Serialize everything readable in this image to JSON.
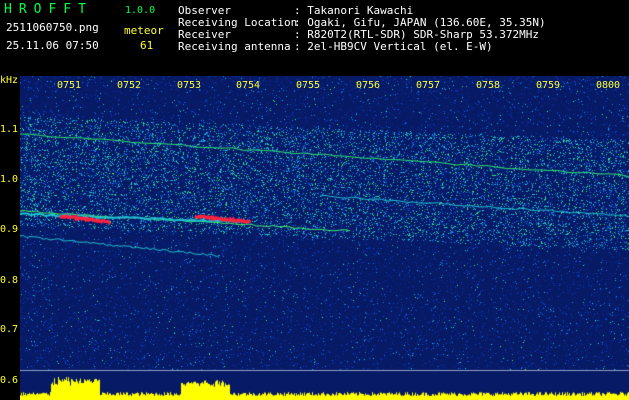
{
  "header": {
    "app_title": "HROFFT",
    "version": "1.0.0",
    "filename": "2511060750.png",
    "datetime": "25.11.06 07:50",
    "meteor_label": "meteor",
    "meteor_count": "61"
  },
  "info": [
    {
      "key": "Observer",
      "value": ": Takanori Kawachi"
    },
    {
      "key": "Receiving Location",
      "value": ": Ogaki, Gifu, JAPAN (136.60E, 35.35N)"
    },
    {
      "key": "Receiver",
      "value": ": R820T2(RTL-SDR) SDR-Sharp 53.372MHz"
    },
    {
      "key": "Receiving antenna",
      "value": ": 2el-HB9CV Vertical (el. E-W)"
    }
  ],
  "axis": {
    "unit": "kHz",
    "y_ticks": [
      "1.1",
      "1.0",
      "0.9",
      "0.8",
      "0.7",
      "0.6"
    ],
    "x_ticks": [
      "0751",
      "0752",
      "0753",
      "0754",
      "0755",
      "0756",
      "0757",
      "0758",
      "0759",
      "0800"
    ]
  },
  "colors": {
    "background": "#000000",
    "noise": "#0a2a8c",
    "signal": "#00ff66",
    "echo": "#ff2040",
    "level": "#ffff00"
  }
}
